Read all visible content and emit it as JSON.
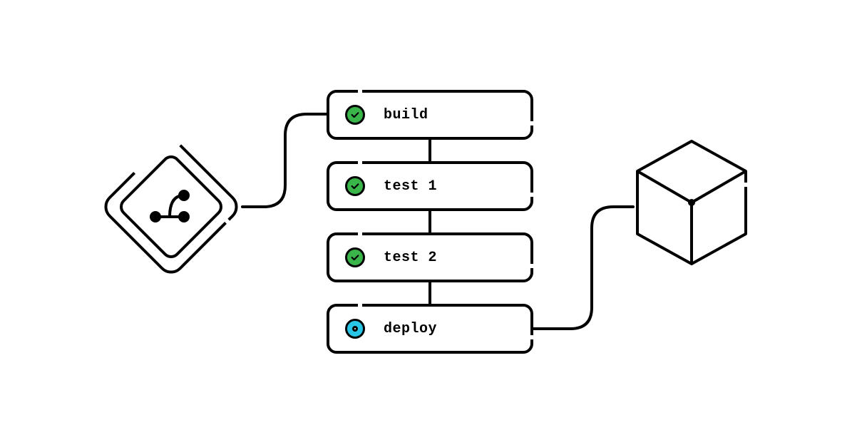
{
  "pipeline": {
    "stages": [
      {
        "label": "build",
        "status": "success"
      },
      {
        "label": "test 1",
        "status": "success"
      },
      {
        "label": "test 2",
        "status": "success"
      },
      {
        "label": "deploy",
        "status": "running"
      }
    ]
  },
  "icons": {
    "source": "git-branch-icon",
    "target": "cube-icon"
  },
  "colors": {
    "stroke": "#000000",
    "success": "#39b54a",
    "running": "#29c5e6",
    "background": "#ffffff"
  }
}
